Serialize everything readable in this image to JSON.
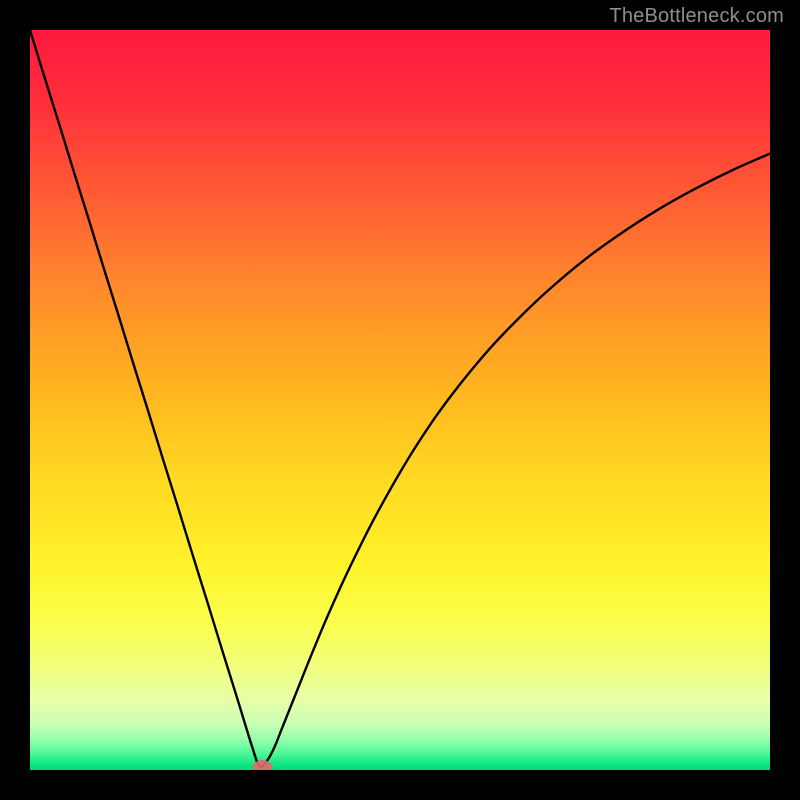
{
  "watermark": "TheBottleneck.com",
  "chart_data": {
    "type": "line",
    "title": "",
    "xlabel": "",
    "ylabel": "",
    "xlim": [
      0,
      100
    ],
    "ylim": [
      0,
      100
    ],
    "grid": false,
    "legend": false,
    "series": [
      {
        "name": "curve",
        "color": "#000000",
        "x": [
          0,
          2,
          4,
          6,
          8,
          10,
          12,
          14,
          16,
          18,
          20,
          22,
          24,
          26,
          28,
          30,
          31,
          32,
          33,
          34,
          35,
          36,
          38,
          40,
          42,
          44,
          46,
          48,
          50,
          52,
          55,
          58,
          62,
          66,
          70,
          75,
          80,
          85,
          90,
          95,
          100
        ],
        "y": [
          100,
          93.5,
          87.1,
          80.6,
          74.2,
          67.7,
          61.3,
          54.8,
          48.4,
          41.9,
          35.5,
          29.0,
          22.6,
          16.1,
          9.7,
          3.2,
          0.5,
          1.2,
          3.0,
          5.5,
          8.0,
          10.5,
          15.5,
          20.3,
          24.8,
          29.0,
          33.0,
          36.7,
          40.2,
          43.5,
          48.0,
          52.0,
          56.8,
          61.0,
          64.8,
          69.0,
          72.6,
          75.8,
          78.6,
          81.1,
          83.3
        ]
      }
    ],
    "marker": {
      "x": 31.4,
      "y": 0.4,
      "color": "#e06b6b",
      "rx": 10,
      "ry": 7
    },
    "background_gradient": {
      "stops": [
        {
          "offset": 0.0,
          "color": "#ff193e"
        },
        {
          "offset": 0.1,
          "color": "#ff2f3b"
        },
        {
          "offset": 0.22,
          "color": "#ff5a34"
        },
        {
          "offset": 0.35,
          "color": "#ff8a2c"
        },
        {
          "offset": 0.48,
          "color": "#ffb31f"
        },
        {
          "offset": 0.6,
          "color": "#ffd722"
        },
        {
          "offset": 0.72,
          "color": "#fff22a"
        },
        {
          "offset": 0.8,
          "color": "#fbff4b"
        },
        {
          "offset": 0.86,
          "color": "#f1ff7c"
        },
        {
          "offset": 0.905,
          "color": "#e8ffa6"
        },
        {
          "offset": 0.935,
          "color": "#cdffb5"
        },
        {
          "offset": 0.958,
          "color": "#97ffab"
        },
        {
          "offset": 0.976,
          "color": "#55f99a"
        },
        {
          "offset": 0.99,
          "color": "#17e985"
        },
        {
          "offset": 1.0,
          "color": "#00da79"
        }
      ]
    }
  }
}
